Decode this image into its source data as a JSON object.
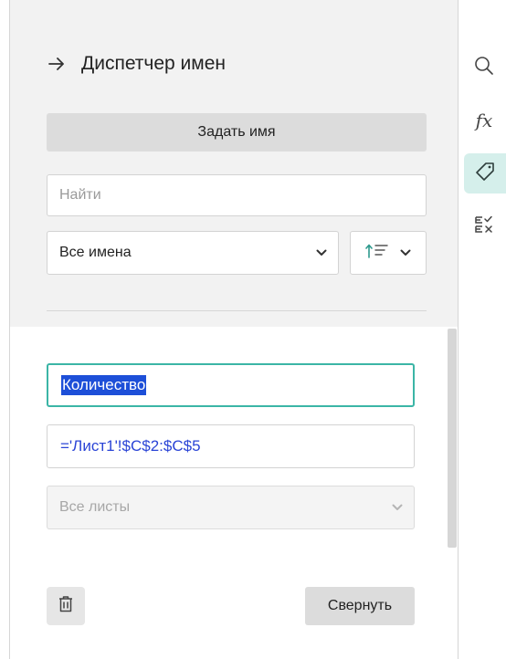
{
  "panel": {
    "title": "Диспетчер имен",
    "define_name_label": "Задать имя",
    "search": {
      "placeholder": "Найти"
    },
    "filter_select": {
      "value": "Все имена"
    }
  },
  "editor": {
    "name_value": "Количество",
    "formula_value": "='Лист1'!$C$2:$C$5",
    "scope_value": "Все листы",
    "collapse_label": "Свернуть"
  },
  "toolbar": {
    "items": [
      {
        "icon": "search-icon",
        "active": false
      },
      {
        "icon": "function-icon",
        "label": "fx",
        "active": false
      },
      {
        "icon": "tag-icon",
        "active": true
      },
      {
        "icon": "checklist-icon",
        "active": false
      }
    ]
  },
  "colors": {
    "accent": "#3bb5a6",
    "active_tab_bg": "#d5efeb",
    "formula_text": "#2a44d6",
    "selection": "#1d4fd8"
  }
}
